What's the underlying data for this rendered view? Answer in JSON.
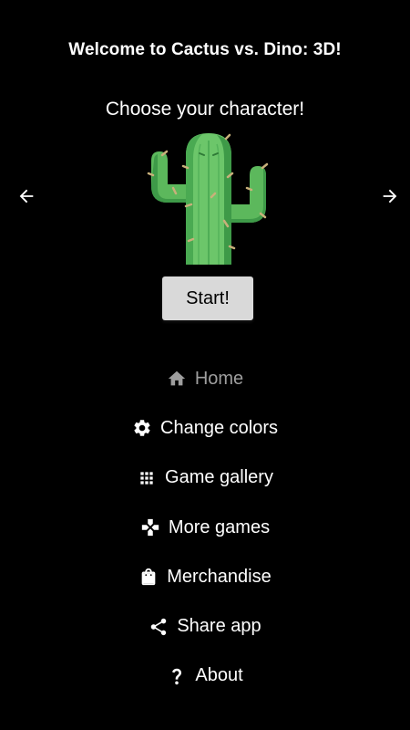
{
  "header": {
    "title": "Welcome to Cactus vs. Dino: 3D!",
    "subtitle": "Choose your character!"
  },
  "carousel": {
    "prev_icon": "arrow-left-icon",
    "next_icon": "arrow-right-icon",
    "character_icon": "cactus-icon"
  },
  "start_button": {
    "label": "Start!"
  },
  "menu": {
    "items": [
      {
        "label": "Home",
        "icon": "home-icon",
        "active": true
      },
      {
        "label": "Change colors",
        "icon": "gear-icon"
      },
      {
        "label": "Game gallery",
        "icon": "grid-icon"
      },
      {
        "label": "More games",
        "icon": "gamepad-icon"
      },
      {
        "label": "Merchandise",
        "icon": "shopping-bag-icon"
      },
      {
        "label": "Share app",
        "icon": "share-icon"
      },
      {
        "label": "About",
        "icon": "question-icon"
      }
    ]
  },
  "colors": {
    "background": "#000000",
    "text": "#ffffff",
    "active_text": "#9e9e9e",
    "button_bg": "#d9d9d9",
    "cactus_green": "#5cb85c",
    "cactus_spine": "#c8b07a"
  }
}
